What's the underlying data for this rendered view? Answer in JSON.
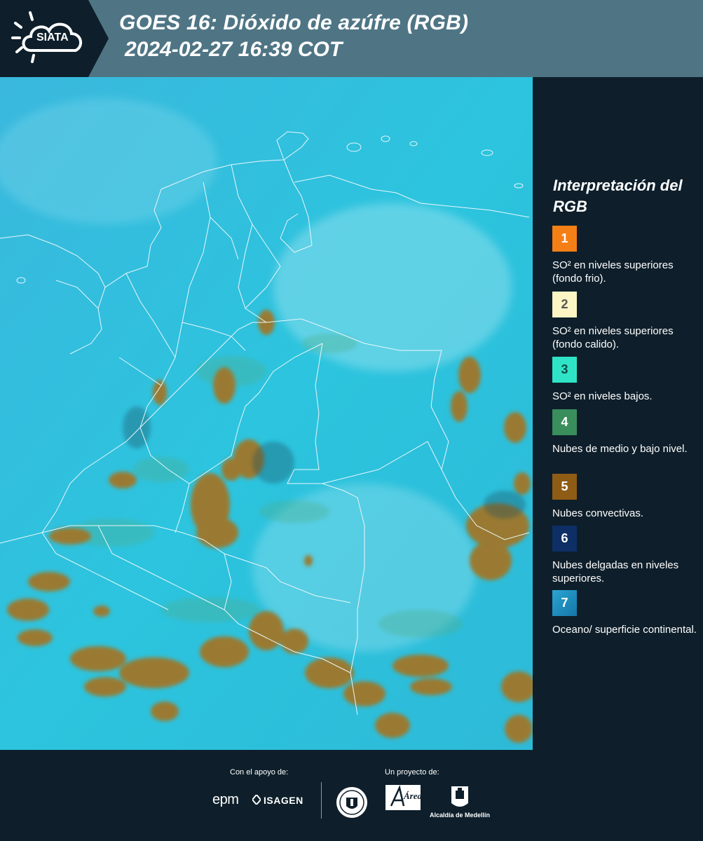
{
  "header": {
    "logo_text": "SIATA",
    "title": "GOES 16: Dióxido de azúfre (RGB)",
    "datetime": "2024-02-27 16:39 COT"
  },
  "map": {
    "ocean_land_color": "#2ec0de",
    "border_color": "#e8f6fa",
    "convective_cloud_color": "#9a7a32"
  },
  "legend": {
    "title": "Interpretación del RGB",
    "items": [
      {
        "number": "1",
        "color": "#f57f17",
        "number_color": "#ffffff",
        "text": "SO² en niveles superiores (fondo frio)."
      },
      {
        "number": "2",
        "color": "#fdf5c4",
        "number_color": "#555555",
        "text": "SO² en niveles superiores (fondo calido)."
      },
      {
        "number": "3",
        "color": "#2fe3c6",
        "number_color": "#0e4a45",
        "text": "SO² en niveles bajos."
      },
      {
        "number": "4",
        "color": "#3a8e5c",
        "number_color": "#ffffff",
        "text": "Nubes de medio y bajo nivel."
      },
      {
        "number": "5",
        "color": "#8f5c16",
        "number_color": "#ffffff",
        "text": "Nubes convectivas."
      },
      {
        "number": "6",
        "color": "#0d2f66",
        "number_color": "#ffffff",
        "text": "Nubes delgadas en niveles superiores."
      },
      {
        "number": "7",
        "color": "#1f8ec4",
        "number_color": "#ffffff",
        "text": "Oceano/ superficie continental."
      }
    ]
  },
  "footer": {
    "support_label": "Con el apoyo de:",
    "project_label": "Un proyecto de:",
    "sponsor_epm": "epm",
    "sponsor_isagen": "ISAGEN",
    "area_name": "Área",
    "area_subtitle": "METROPOLITANA Valle de Aburrá",
    "alcaldia": "Alcaldía de Medellín"
  }
}
